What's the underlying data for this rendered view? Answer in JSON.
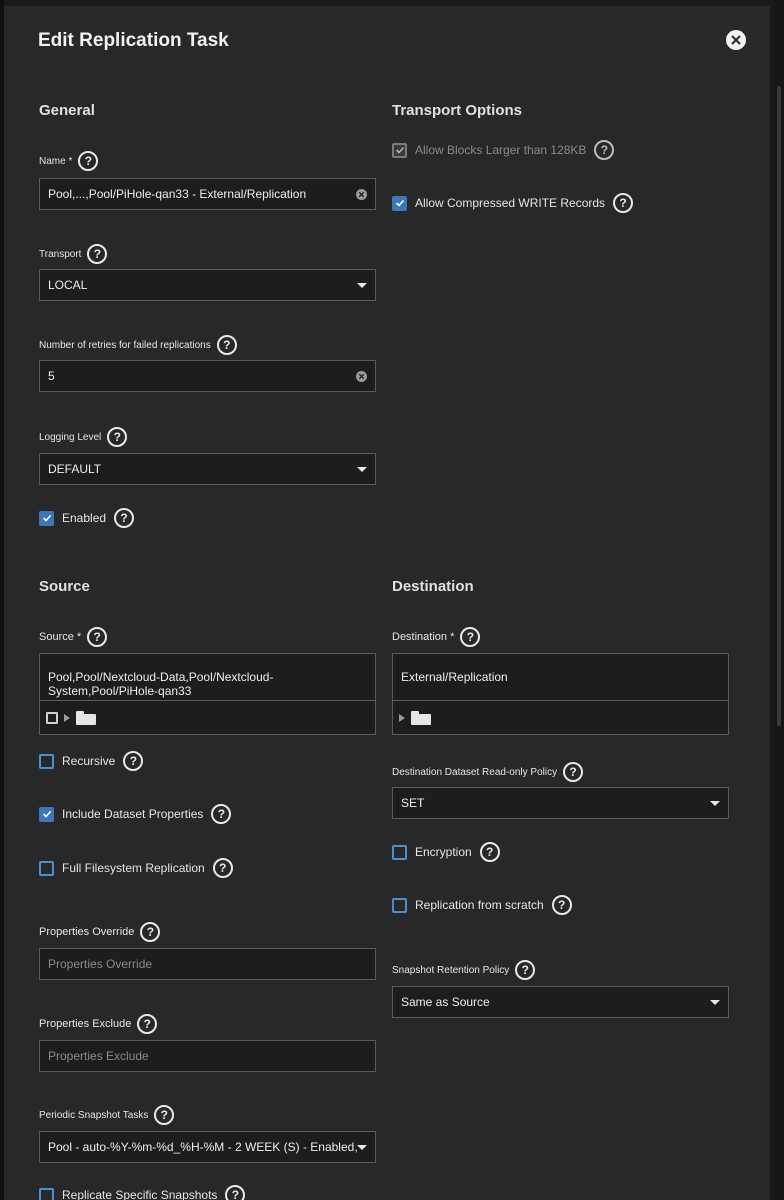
{
  "dialog": {
    "title": "Edit Replication Task"
  },
  "general": {
    "title": "General",
    "name": {
      "label": "Name *",
      "value": "Pool,...,Pool/PiHole-qan33 - External/Replication"
    },
    "transport": {
      "label": "Transport",
      "value": "LOCAL"
    },
    "retries": {
      "label": "Number of retries for failed replications",
      "value": "5"
    },
    "logging": {
      "label": "Logging Level",
      "value": "DEFAULT"
    },
    "enabled": {
      "label": "Enabled",
      "checked": true
    }
  },
  "transport_options": {
    "title": "Transport Options",
    "large_blocks": {
      "label": "Allow Blocks Larger than 128KB",
      "checked": true,
      "disabled": true
    },
    "compressed": {
      "label": "Allow Compressed WRITE Records",
      "checked": true
    }
  },
  "source": {
    "title": "Source",
    "field": {
      "label": "Source *",
      "value": "Pool,Pool/Nextcloud-Data,Pool/Nextcloud-System,Pool/PiHole-qan33"
    },
    "recursive": {
      "label": "Recursive",
      "checked": false
    },
    "include_props": {
      "label": "Include Dataset Properties",
      "checked": true
    },
    "full_fs": {
      "label": "Full Filesystem Replication",
      "checked": false
    },
    "props_override": {
      "label": "Properties Override",
      "placeholder": "Properties Override"
    },
    "props_exclude": {
      "label": "Properties Exclude",
      "placeholder": "Properties Exclude"
    },
    "periodic": {
      "label": "Periodic Snapshot Tasks",
      "value": "Pool - auto-%Y-%m-%d_%H-%M - 2 WEEK (S) - Enabled, ..."
    },
    "specific": {
      "label": "Replicate Specific Snapshots",
      "checked": false
    }
  },
  "destination": {
    "title": "Destination",
    "field": {
      "label": "Destination *",
      "value": "External/Replication"
    },
    "readonly_policy": {
      "label": "Destination Dataset Read-only Policy",
      "value": "SET"
    },
    "encryption": {
      "label": "Encryption",
      "checked": false
    },
    "from_scratch": {
      "label": "Replication from scratch",
      "checked": false
    },
    "retention": {
      "label": "Snapshot Retention Policy",
      "value": "Same as Source"
    }
  },
  "colors": {
    "dialog_bg": "#282828",
    "field_bg": "#1d1d1d",
    "accent": "#3b78b5"
  }
}
